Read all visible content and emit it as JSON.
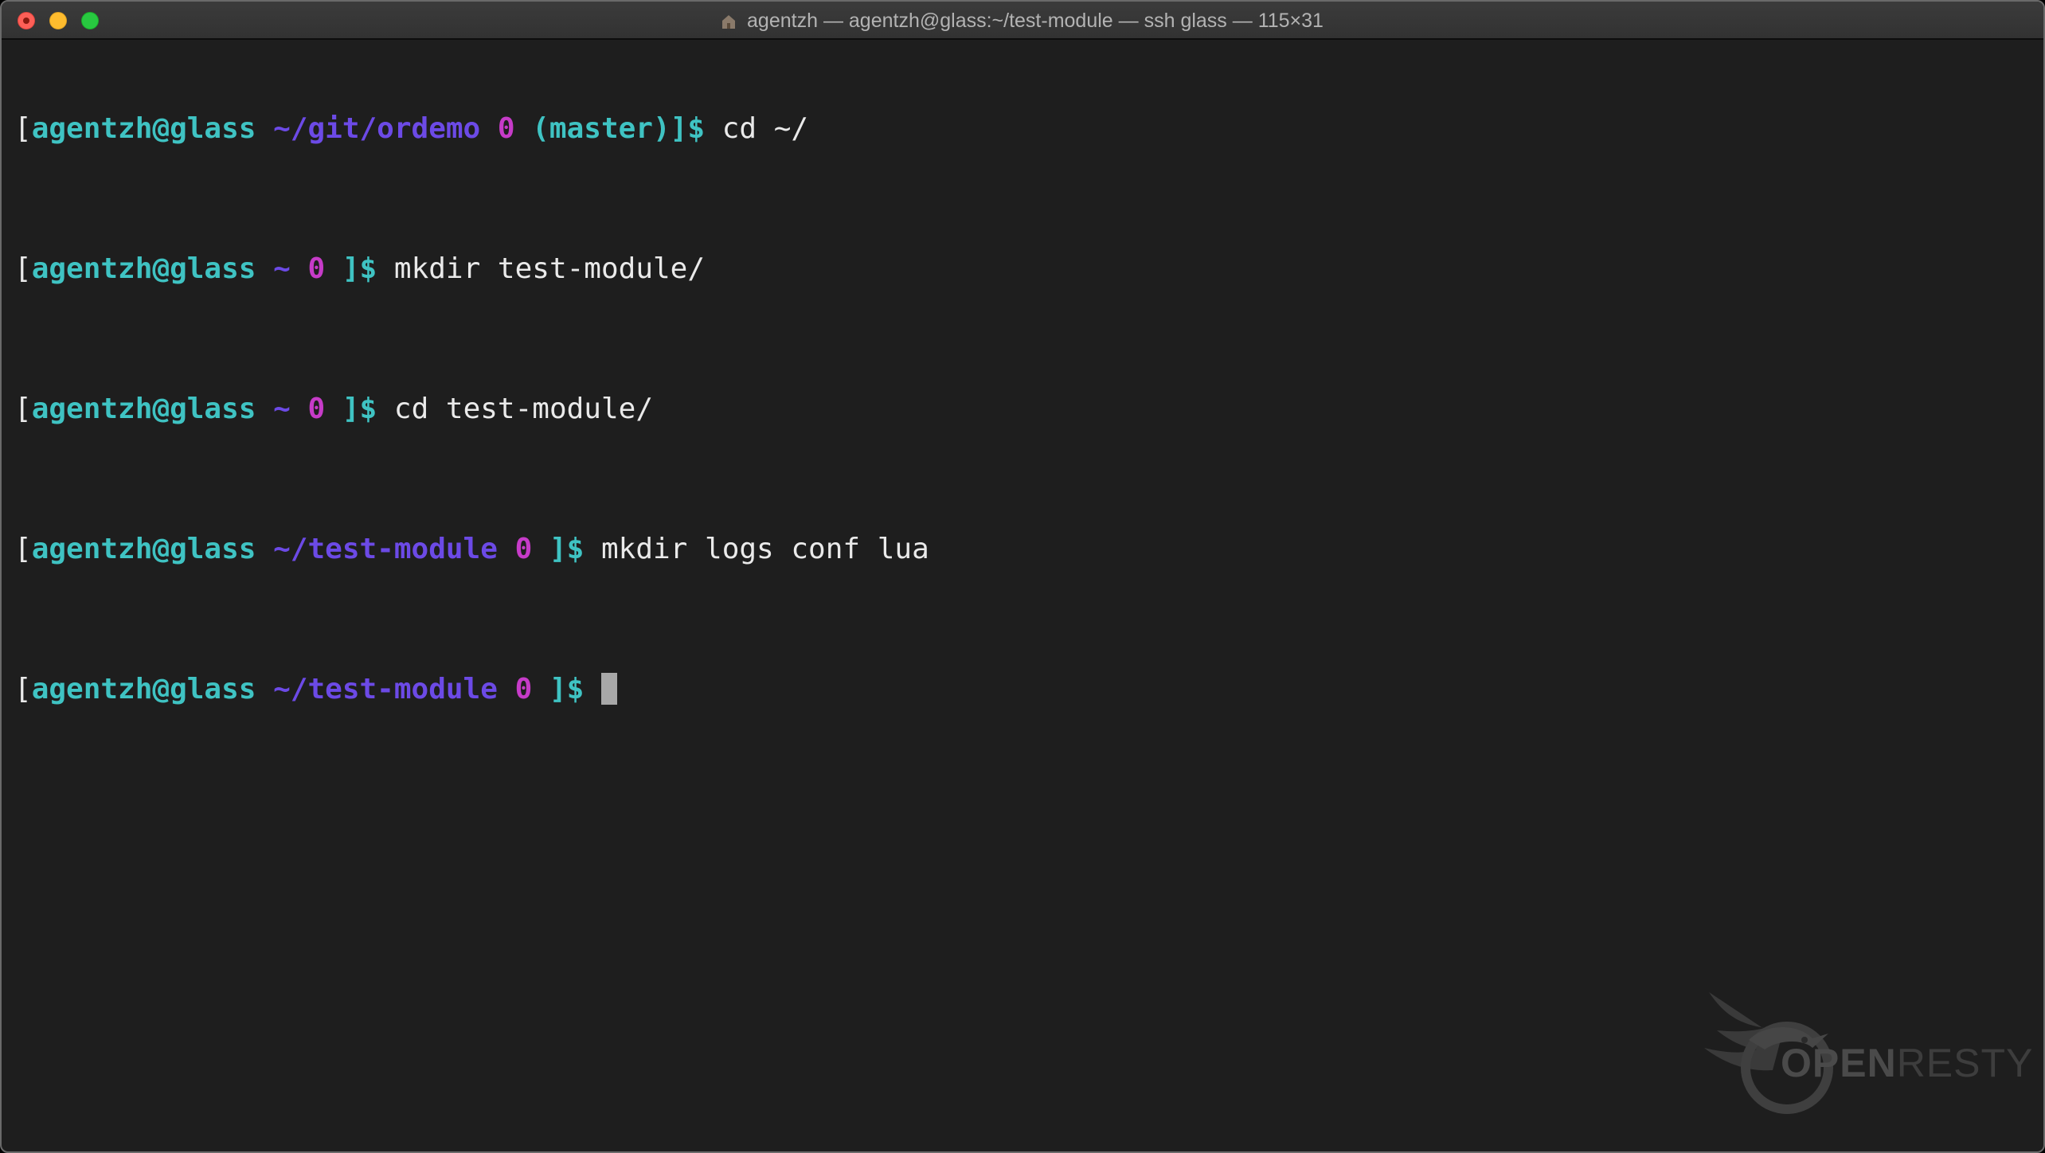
{
  "window": {
    "title": "agentzh — agentzh@glass:~/test-module — ssh glass — 115×31"
  },
  "terminal": {
    "lines": [
      {
        "open": "[",
        "user": "agentzh@glass",
        "path": " ~/git/ordemo",
        "code": " 0",
        "branch": " (master)",
        "close": "]$",
        "command": " cd ~/"
      },
      {
        "open": "[",
        "user": "agentzh@glass",
        "path": " ~",
        "code": " 0",
        "branch": " ",
        "close": "]$",
        "command": " mkdir test-module/"
      },
      {
        "open": "[",
        "user": "agentzh@glass",
        "path": " ~",
        "code": " 0",
        "branch": " ",
        "close": "]$",
        "command": " cd test-module/"
      },
      {
        "open": "[",
        "user": "agentzh@glass",
        "path": " ~/test-module",
        "code": " 0",
        "branch": " ",
        "close": "]$",
        "command": " mkdir logs conf lua"
      },
      {
        "open": "[",
        "user": "agentzh@glass",
        "path": " ~/test-module",
        "code": " 0",
        "branch": " ",
        "close": "]$",
        "command": " "
      }
    ]
  },
  "watermark": {
    "open": "OPEN",
    "resty": "RESTY"
  },
  "colors": {
    "background": "#1e1e1e",
    "user": "#3fc3c3",
    "path": "#6c4ae6",
    "exit_code": "#c63bc8",
    "text": "#eaeaea"
  }
}
